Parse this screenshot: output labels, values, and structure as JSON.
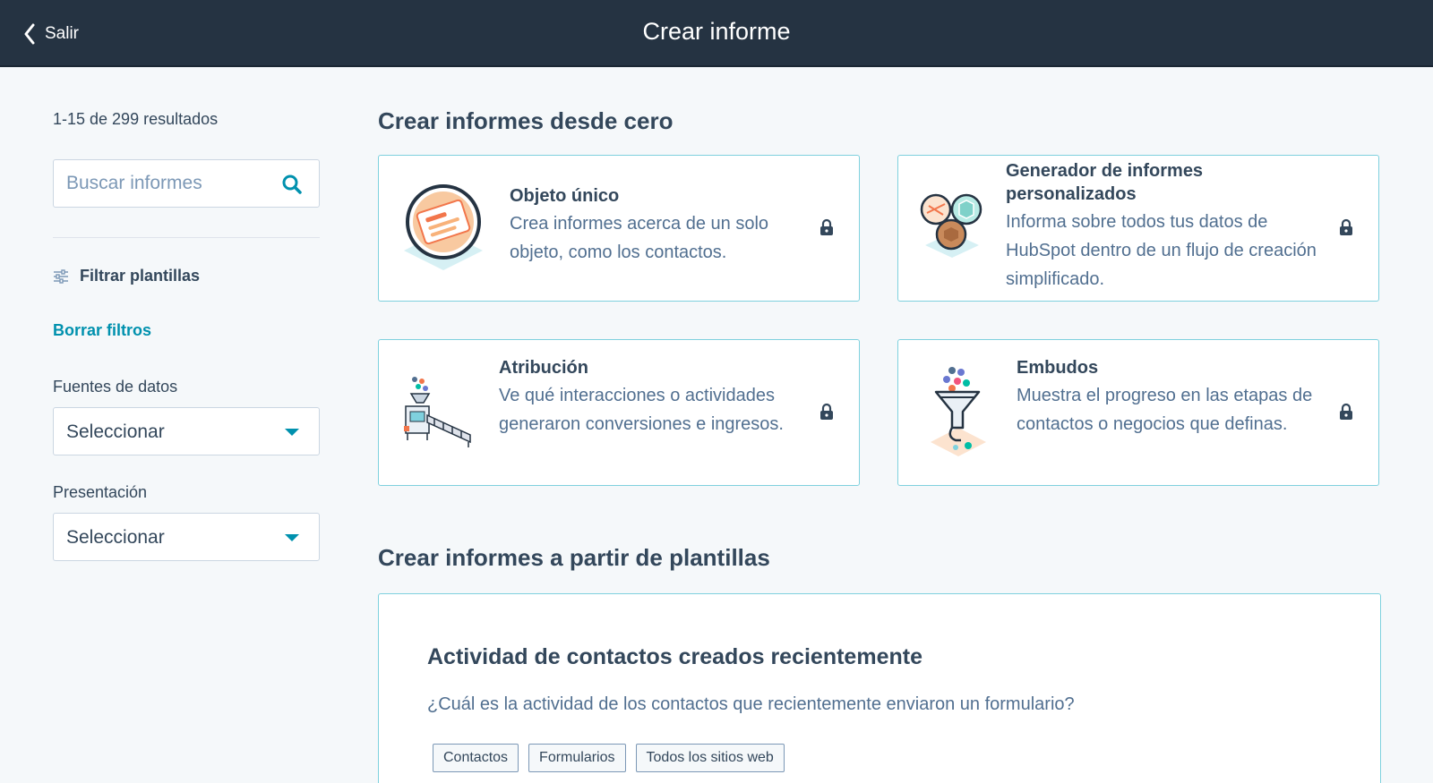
{
  "header": {
    "back_label": "Salir",
    "title": "Crear informe"
  },
  "sidebar": {
    "results_text": "1-15 de 299 resultados",
    "search_placeholder": "Buscar informes",
    "filter_label": "Filtrar plantillas",
    "clear_label": "Borrar filtros",
    "data_sources": {
      "label": "Fuentes de datos",
      "value": "Seleccionar"
    },
    "presentation": {
      "label": "Presentación",
      "value": "Seleccionar"
    }
  },
  "main": {
    "scratch_title": "Crear informes desde cero",
    "cards": [
      {
        "title": "Objeto único",
        "description": "Crea informes acerca de un solo objeto, como los contactos.",
        "locked": true
      },
      {
        "title": "Generador de informes personalizados",
        "description": "Informa sobre todos tus datos de HubSpot dentro de un flujo de creación simplificado.",
        "locked": true
      },
      {
        "title": "Atribución",
        "description": "Ve qué interacciones o actividades generaron conversiones e ingresos.",
        "locked": true
      },
      {
        "title": "Embudos",
        "description": "Muestra el progreso en las etapas de contactos o negocios que definas.",
        "locked": true
      }
    ],
    "templates_title": "Crear informes a partir de plantillas",
    "template": {
      "title": "Actividad de contactos creados recientemente",
      "description": "¿Cuál es la actividad de los contactos que recientemente enviaron un formulario?",
      "tags": [
        "Contactos",
        "Formularios",
        "Todos los sitios web"
      ]
    }
  },
  "colors": {
    "header_bg": "#253342",
    "accent": "#0091ae",
    "card_border": "#7fd1de",
    "text": "#33475b"
  }
}
